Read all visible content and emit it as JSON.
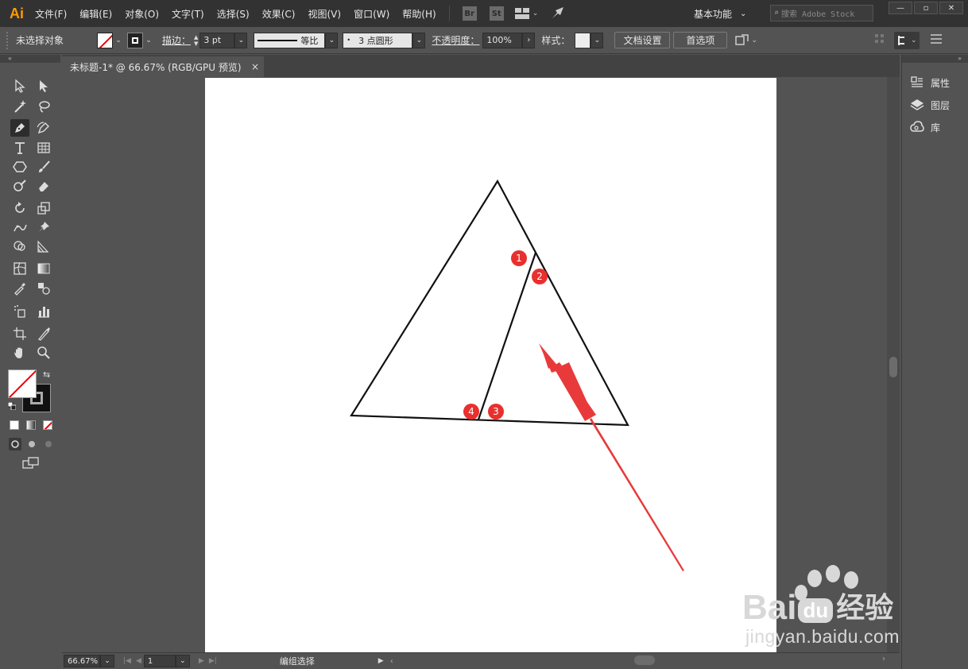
{
  "app": {
    "logo_text": "Ai"
  },
  "menu": [
    "文件(F)",
    "编辑(E)",
    "对象(O)",
    "文字(T)",
    "选择(S)",
    "效果(C)",
    "视图(V)",
    "窗口(W)",
    "帮助(H)"
  ],
  "menubar_icons": {
    "bridge": "Br",
    "stock": "St"
  },
  "workspace": {
    "label": "基本功能"
  },
  "stock_search": {
    "placeholder": "搜索 Adobe Stock"
  },
  "control_bar": {
    "selection_label": "未选择对象",
    "stroke_label": "描边：",
    "stroke_weight": "3 pt",
    "profile_label": "等比",
    "brush_label": "3 点圆形",
    "opacity_label": "不透明度：",
    "opacity_value": "100%",
    "style_label": "样式：",
    "doc_setup_label": "文档设置",
    "prefs_label": "首选项"
  },
  "document": {
    "tab_title": "未标题-1* @ 66.67% (RGB/GPU 预览)",
    "close_symbol": "×"
  },
  "status_bar": {
    "zoom": "66.67%",
    "artboard_number": "1",
    "status_text": "编组选择"
  },
  "right_panel": {
    "items": [
      "属性",
      "图层",
      "库"
    ]
  },
  "annotations": {
    "markers": [
      "1",
      "2",
      "3",
      "4"
    ],
    "marker_color": "#e8302f",
    "arrow_color": "#e83a3a"
  },
  "watermark": {
    "brand": "Bai",
    "brand_suffix": "du",
    "cn_text": "经验",
    "url": "jingyan.baidu.com"
  },
  "colors": {
    "menubar_bg": "#323232",
    "panel_bg": "#535353",
    "accent_logo": "#ff9a00"
  }
}
